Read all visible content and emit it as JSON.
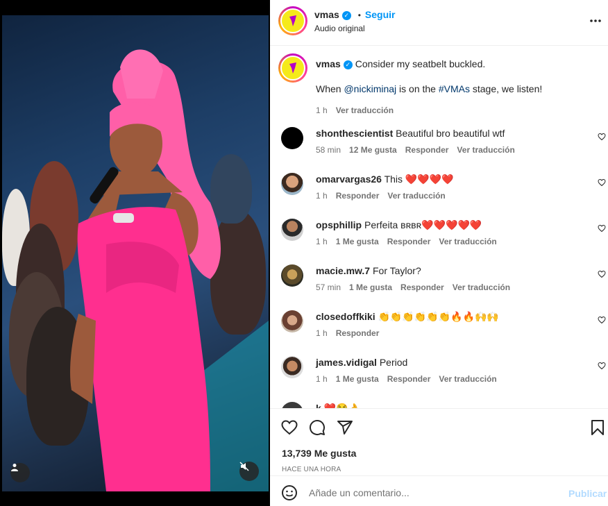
{
  "post": {
    "username": "vmas",
    "follow_label": "Seguir",
    "audio": "Audio original",
    "caption_line1": "Consider my seatbelt buckled.",
    "caption_line2_prefix": "When ",
    "caption_mention": "@nickiminaj",
    "caption_line2_mid": " is on the ",
    "caption_hashtag": "#VMAs",
    "caption_line2_suffix": " stage, we listen!",
    "caption_time": "1 h",
    "caption_translate": "Ver traducción"
  },
  "comments": [
    {
      "user": "shonthescientist",
      "text": "Beautiful bro beautiful wtf",
      "time": "58 min",
      "likes": "12 Me gusta",
      "reply": "Responder",
      "translate": "Ver traducción"
    },
    {
      "user": "omarvargas26",
      "text": "This ❤️❤️❤️❤️",
      "time": "1 h",
      "likes": "",
      "reply": "Responder",
      "translate": "Ver traducción"
    },
    {
      "user": "opsphillip",
      "text": "Perfeita ʙʀʙʀ❤️❤️❤️❤️❤️",
      "time": "1 h",
      "likes": "1 Me gusta",
      "reply": "Responder",
      "translate": "Ver traducción"
    },
    {
      "user": "macie.mw.7",
      "text": "For Taylor?",
      "time": "57 min",
      "likes": "1 Me gusta",
      "reply": "Responder",
      "translate": "Ver traducción"
    },
    {
      "user": "closedoffkiki",
      "text": "👏👏👏👏👏👏🔥🔥🙌🙌",
      "time": "1 h",
      "likes": "",
      "reply": "Responder",
      "translate": ""
    },
    {
      "user": "james.vidigal",
      "text": "Period",
      "time": "1 h",
      "likes": "1 Me gusta",
      "reply": "Responder",
      "translate": "Ver traducción"
    },
    {
      "user": "k",
      "text": "❤️😂👌",
      "time": "",
      "likes": "",
      "reply": "",
      "translate": ""
    }
  ],
  "footer": {
    "likes_count": "13,739 Me gusta",
    "time_ago": "HACE UNA HORA",
    "comment_placeholder": "Añade un comentario...",
    "publish_label": "Publicar"
  },
  "colors": {
    "accent": "#0095f6",
    "heart_red": "#ed4956",
    "dress_pink": "#ff2f8f"
  },
  "icons": [
    "more-icon",
    "verified-icon",
    "heart-icon",
    "comment-icon",
    "share-icon",
    "save-icon",
    "emoji-icon",
    "user-tag-icon",
    "mute-icon"
  ]
}
